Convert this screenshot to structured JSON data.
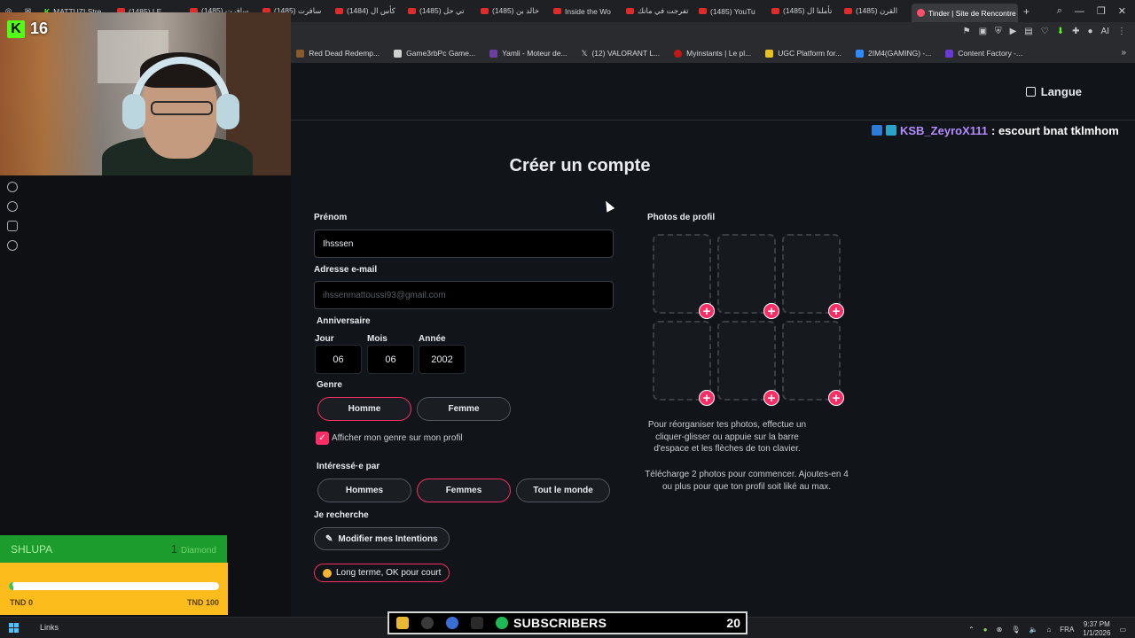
{
  "browser": {
    "tabs": [
      {
        "label": "",
        "icon": "target-icon"
      },
      {
        "label": "",
        "icon": "mail-icon"
      },
      {
        "label": "MATTUZI Stre",
        "icon": "kick-icon"
      },
      {
        "label": "(1485) LE",
        "icon": "youtube-icon"
      },
      {
        "label": "(1485) سافرت",
        "icon": "youtube-icon"
      },
      {
        "label": "(1485) سافرت",
        "icon": "youtube-icon"
      },
      {
        "label": "(1484) كأس ال",
        "icon": "youtube-icon"
      },
      {
        "label": "(1485) تي حل",
        "icon": "youtube-icon"
      },
      {
        "label": "(1485) خالد بن",
        "icon": "youtube-icon"
      },
      {
        "label": "Inside the Wo",
        "icon": "youtube-icon"
      },
      {
        "label": "تفرجت في مانك",
        "icon": "youtube-icon"
      },
      {
        "label": "(1485) YouTu",
        "icon": "youtube-icon"
      },
      {
        "label": "(1485) تأملنا ال",
        "icon": "youtube-icon"
      },
      {
        "label": "(1485) القرن",
        "icon": "youtube-icon"
      }
    ],
    "active_tab": "Tinder | Site de Rencontre",
    "new_tab": "+",
    "bookmarks": [
      {
        "label": "Red Dead Redemp...",
        "color": "#8b5a2b"
      },
      {
        "label": "Game3rbPc Game...",
        "color": "#d0d0d0"
      },
      {
        "label": "Yamli - Moteur de...",
        "color": "#6b3fa0"
      },
      {
        "label": "(12) VALORANT L...",
        "color": "#000000"
      },
      {
        "label": "Myinstants | Le pl...",
        "color": "#c01818"
      },
      {
        "label": "UGC Platform for...",
        "color": "#e8c020"
      },
      {
        "label": "2IM4(GAMING) -...",
        "color": "#2e8bff"
      },
      {
        "label": "Content Factory -...",
        "color": "#6a3ad8"
      }
    ],
    "bookmark_partial": "k"
  },
  "stream": {
    "kick_count": "16",
    "chat_user": "KSB_ZeyroX111",
    "chat_message": ": escourt bnat tklmhom",
    "donation": {
      "name": "SHLUPA",
      "amount": "1",
      "unit": "Diamond",
      "progress": 0.02,
      "bar_marker": "6",
      "min_label": "TND 0",
      "max_label": "TND 100"
    },
    "subscribers_label": "SUBSCRIBERS",
    "subscribers_count": "20"
  },
  "header": {
    "language_label": "Langue"
  },
  "form": {
    "title": "Créer un compte",
    "first_name_label": "Prénom",
    "first_name_value": "Ihsssen",
    "email_label": "Adresse e-mail",
    "email_placeholder": "ihssenmattoussi93@gmail.com",
    "birthday_label": "Anniversaire",
    "day_label": "Jour",
    "day_value": "06",
    "month_label": "Mois",
    "month_value": "06",
    "year_label": "Année",
    "year_value": "2002",
    "gender_label": "Genre",
    "gender_options": [
      "Homme",
      "Femme"
    ],
    "gender_selected": "Homme",
    "show_gender_label": "Afficher mon genre sur mon profil",
    "show_gender_checked": true,
    "interested_label": "Intéressé·e par",
    "interested_options": [
      "Hommes",
      "Femmes",
      "Tout le monde"
    ],
    "interested_selected": "Femmes",
    "looking_for_label": "Je recherche",
    "edit_intentions_label": "Modifier mes Intentions",
    "intention_tag": "Long terme, OK pour court"
  },
  "photos": {
    "label": "Photos de profil",
    "slots": 6,
    "reorder_text": "Pour réorganiser tes photos, effectue un cliquer-glisser ou appuie sur la barre d'espace et les flèches de ton clavier.",
    "upload_text": "Télécharge 2 photos pour commencer. Ajoutes-en 4 ou plus pour que ton profil soit liké au max."
  },
  "taskbar": {
    "links_label": "Links",
    "language": "FRA",
    "time": "9:37 PM",
    "date": "1/1/2026"
  },
  "colors": {
    "accent": "#fd2e66",
    "background": "#111418",
    "kick_green": "#53fc18"
  }
}
